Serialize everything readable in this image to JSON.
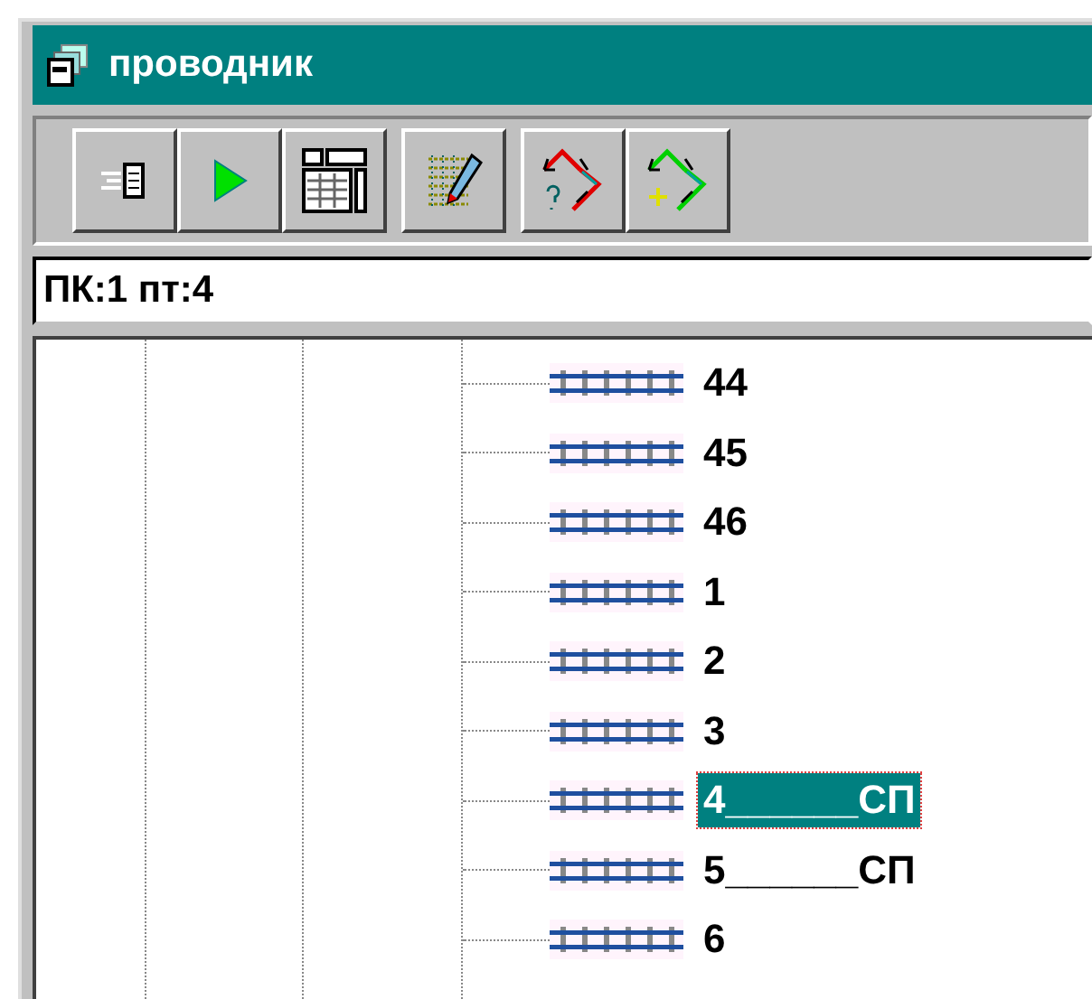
{
  "window": {
    "title": "проводник"
  },
  "toolbar": {
    "buttons": [
      {
        "kind": "collapse"
      },
      {
        "kind": "play"
      },
      {
        "kind": "table"
      },
      {
        "kind": "edit"
      },
      {
        "kind": "query"
      },
      {
        "kind": "add"
      }
    ]
  },
  "status_field": {
    "value": "ПК:1 пт:4"
  },
  "tree": {
    "items": [
      {
        "label": "44",
        "selected": false
      },
      {
        "label": "45",
        "selected": false
      },
      {
        "label": "46",
        "selected": false
      },
      {
        "label": "1",
        "selected": false
      },
      {
        "label": "2",
        "selected": false
      },
      {
        "label": "3",
        "selected": false
      },
      {
        "label": "4______СП",
        "selected": true
      },
      {
        "label": "5______СП",
        "selected": false
      },
      {
        "label": "6",
        "selected": false
      }
    ]
  }
}
